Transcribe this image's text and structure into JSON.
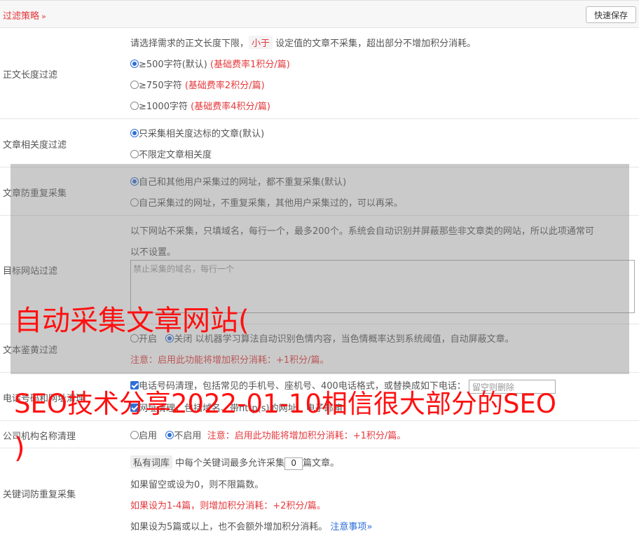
{
  "header": {
    "title": "过滤策略",
    "save_label": "快速保存"
  },
  "length_filter": {
    "label": "正文长度过滤",
    "desc_pre": "请选择需求的正文长度下限，",
    "desc_tag": "小于",
    "desc_post": "设定值的文章不采集，超出部分不增加积分消耗。",
    "options": [
      {
        "text": "≥500字符(默认)",
        "note": "(基础费率1积分/篇)",
        "selected": true
      },
      {
        "text": "≥750字符",
        "note": "(基础费率2积分/篇)",
        "selected": false
      },
      {
        "text": "≥1000字符",
        "note": "(基础费率4积分/篇)",
        "selected": false
      }
    ]
  },
  "relevance_filter": {
    "label": "文章相关度过滤",
    "options": [
      {
        "text": "只采集相关度达标的文章(默认)",
        "selected": true
      },
      {
        "text": "不限定文章相关度",
        "selected": false
      }
    ]
  },
  "duplicate_filter": {
    "label": "文章防重复采集",
    "options": [
      {
        "text": "自己和其他用户采集过的网址，都不重复采集(默认)",
        "selected": true
      },
      {
        "text": "自己采集过的网址，不重复采集，其他用户采集过的，可以再采。",
        "selected": false
      }
    ]
  },
  "site_filter": {
    "label": "目标网站过滤",
    "desc1": "以下网站不采集，只填域名，每行一个，最多200个。系统会自动识别并屏蔽那些非文章类的网站，所以此项通常可",
    "desc2": "以不设置。",
    "placeholder": "禁止采集的域名，每行一个"
  },
  "porn_filter": {
    "label": "文本鉴黄过滤",
    "on": "开启",
    "off": "关闭",
    "desc": "以机器学习算法自动识别色情内容，当色情概率达到系统阈值，自动屏蔽文章。",
    "note": "注意：启用此功能将增加积分消耗：+1积分/篇。"
  },
  "phone_filter": {
    "label": "电话号码和网址清理",
    "phone_text": "电话号码清理，包括常见的手机号、座机号、400电话格式，或替换成如下电话：",
    "phone_placeholder": "留空则删除",
    "url_text": "网址清理，包括域名、带http(s)的网址、电子邮箱"
  },
  "company_filter": {
    "label": "公司机构名称清理",
    "on": "启用",
    "off": "不启用",
    "note": "注意：启用此功能将增加积分消耗：+1积分/篇。"
  },
  "keyword_filter": {
    "label": "关键词防重复采集",
    "tag": "私有词库",
    "text_pre": "中每个关键词最多允许采集",
    "value": "0",
    "text_post": "篇文章。",
    "line2": "如果留空或设为0，则不限篇数。",
    "line3": "如果设为1-4篇，则增加积分消耗：+2积分/篇。",
    "line4": "如果设为5篇或以上，也不会额外增加积分消耗。",
    "link": "注意事项"
  },
  "overlay_title": {
    "line1": "自动采集文章网站(",
    "line2": "SEO技术分享2022-01-10相信很大部分的SEO",
    "line3": ")"
  },
  "colors": {
    "accent": "#e4393c",
    "link": "#2d6fd8",
    "overlay_text": "#ff1010"
  }
}
